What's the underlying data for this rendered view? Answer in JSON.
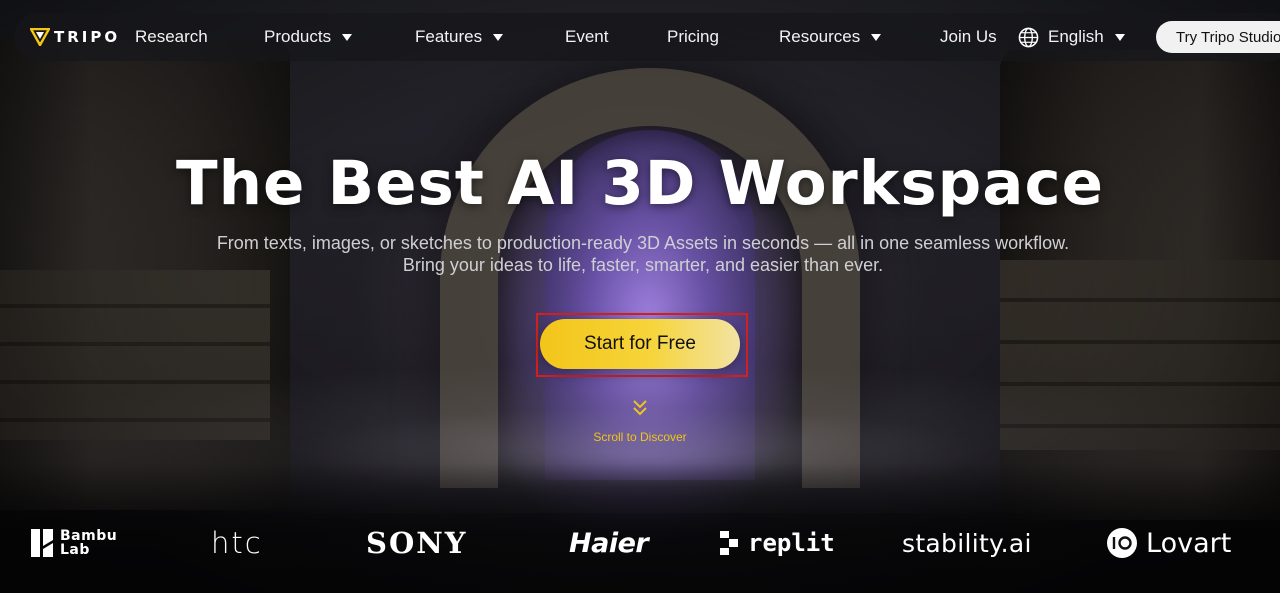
{
  "brand": {
    "logo_text": "TRIPO",
    "research_label": "Research"
  },
  "nav": {
    "items": [
      {
        "label": "Products",
        "has_dropdown": true
      },
      {
        "label": "Features",
        "has_dropdown": true
      },
      {
        "label": "Event",
        "has_dropdown": false
      },
      {
        "label": "Pricing",
        "has_dropdown": false
      },
      {
        "label": "Resources",
        "has_dropdown": true
      },
      {
        "label": "Join Us",
        "has_dropdown": false
      }
    ],
    "language": {
      "label": "English",
      "icon": "globe-icon"
    },
    "cta_label": "Try Tripo Studio"
  },
  "hero": {
    "title": "The Best AI 3D Workspace",
    "subtitle_line1": "From texts, images, or sketches to production-ready 3D Assets in seconds — all in one seamless workflow.",
    "subtitle_line2": "Bring your ideas to life, faster, smarter, and easier than ever.",
    "cta_label": "Start for Free",
    "scroll_label": "Scroll to Discover",
    "scroll_icon": "double-chevron-down-icon"
  },
  "partners": {
    "bambu_line1": "Bambu",
    "bambu_line2": "Lab",
    "htc": "htc",
    "sony": "SONY",
    "haier": "Haier",
    "replit": "replit",
    "stability": "stability.ai",
    "lovart": "Lovart"
  },
  "colors": {
    "accent_yellow": "#f6d43a",
    "highlight_red": "#d62020",
    "nav_bg": "#16161a"
  }
}
